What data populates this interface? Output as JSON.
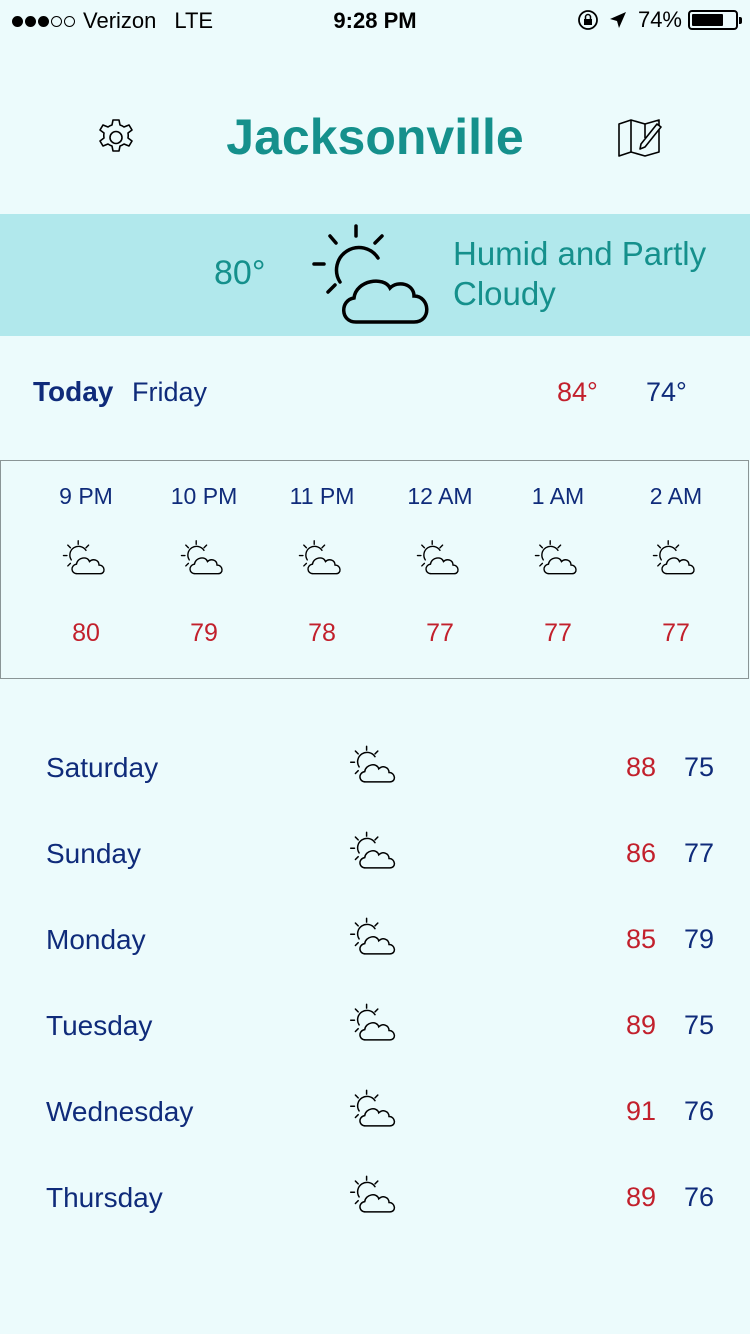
{
  "status_bar": {
    "carrier": "Verizon",
    "network": "LTE",
    "time": "9:28 PM",
    "battery": "74%",
    "battery_level": 0.74,
    "signal_bars_filled": 3,
    "signal_bars_total": 5
  },
  "header": {
    "city": "Jacksonville",
    "settings_icon": "gear-icon",
    "map_icon": "map-edit-icon"
  },
  "current": {
    "temp": "80°",
    "condition": "Humid and Partly Cloudy",
    "icon": "partly-cloudy-icon"
  },
  "today": {
    "label": "Today",
    "day": "Friday",
    "high": "84°",
    "low": "74°"
  },
  "hourly": [
    {
      "time": "9 PM",
      "temp": "80",
      "icon": "partly-cloudy-icon"
    },
    {
      "time": "10 PM",
      "temp": "79",
      "icon": "partly-cloudy-icon"
    },
    {
      "time": "11 PM",
      "temp": "78",
      "icon": "partly-cloudy-icon"
    },
    {
      "time": "12 AM",
      "temp": "77",
      "icon": "partly-cloudy-icon"
    },
    {
      "time": "1 AM",
      "temp": "77",
      "icon": "partly-cloudy-icon"
    },
    {
      "time": "2 AM",
      "temp": "77",
      "icon": "partly-cloudy-icon"
    }
  ],
  "daily": [
    {
      "day": "Saturday",
      "high": "88",
      "low": "75",
      "icon": "partly-cloudy-icon"
    },
    {
      "day": "Sunday",
      "high": "86",
      "low": "77",
      "icon": "partly-cloudy-icon"
    },
    {
      "day": "Monday",
      "high": "85",
      "low": "79",
      "icon": "partly-cloudy-icon"
    },
    {
      "day": "Tuesday",
      "high": "89",
      "low": "75",
      "icon": "partly-cloudy-icon"
    },
    {
      "day": "Wednesday",
      "high": "91",
      "low": "76",
      "icon": "partly-cloudy-icon"
    },
    {
      "day": "Thursday",
      "high": "89",
      "low": "76",
      "icon": "partly-cloudy-icon"
    }
  ],
  "colors": {
    "accent": "#15908c",
    "band": "#b1e8ec",
    "background": "#ecfbfc",
    "high": "#c2202c",
    "low": "#0f2b7a"
  }
}
